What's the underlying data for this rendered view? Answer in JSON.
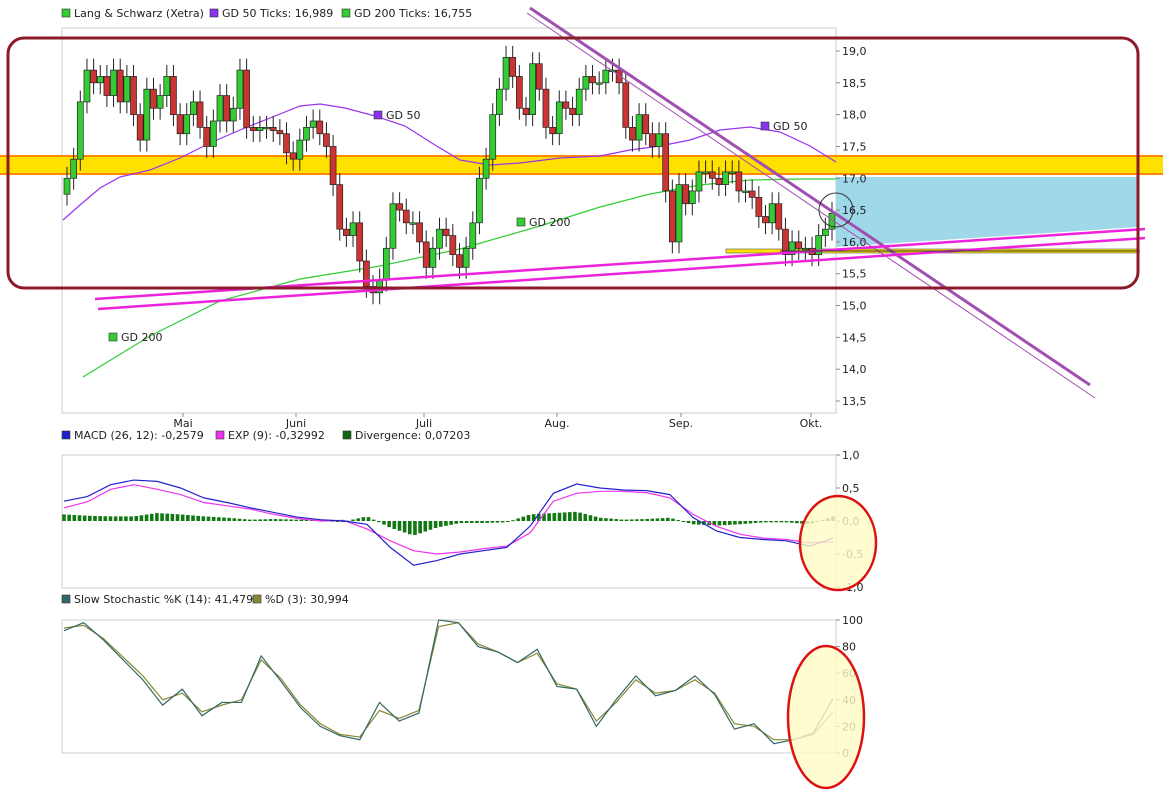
{
  "price_panel": {
    "legend": [
      {
        "label": "Lang & Schwarz (Xetra)",
        "color": "#33cc33"
      },
      {
        "label": "GD 50 Ticks: 16,989",
        "color": "#8833ee"
      },
      {
        "label": "GD 200 Ticks: 16,755",
        "color": "#33cc33"
      }
    ],
    "y_ticks": [
      "19,0",
      "18,5",
      "18,0",
      "17,5",
      "17,0",
      "16,5",
      "16,0",
      "15,5",
      "15,0",
      "14,5",
      "14,0",
      "13,5"
    ],
    "x_ticks": [
      "Mai",
      "Juni",
      "Juli",
      "Aug.",
      "Sep.",
      "Okt."
    ],
    "labels": {
      "gd50_a": "GD 50",
      "gd50_b": "GD 50",
      "gd200_a": "GD 200",
      "gd200_b": "GD 200"
    }
  },
  "macd_panel": {
    "legend": [
      {
        "label": "MACD (26, 12): -0,2579",
        "color": "#2222cc"
      },
      {
        "label": "EXP (9): -0,32992",
        "color": "#ee33ee"
      },
      {
        "label": "Divergence: 0,07203",
        "color": "#116611"
      }
    ],
    "y_ticks": [
      "1,0",
      "0,5",
      "0,0",
      "-0,5",
      "-1,0"
    ]
  },
  "stoch_panel": {
    "legend": [
      {
        "label": "Slow Stochastic %K (14): 41,479",
        "color": "#336666"
      },
      {
        "label": "%D (3): 30,994",
        "color": "#888833"
      }
    ],
    "y_ticks": [
      "100",
      "80",
      "60",
      "40",
      "20",
      "0"
    ]
  },
  "chart_data": [
    {
      "type": "candlestick",
      "title": "Lang & Schwarz (Xetra)",
      "x_ticks": [
        "Mai",
        "Juni",
        "Juli",
        "Aug.",
        "Sep.",
        "Okt."
      ],
      "ylim": [
        13.3,
        19.15
      ],
      "grid": false,
      "series": [
        {
          "name": "Lang & Schwarz (Xetra)",
          "close": [
            17.0,
            17.3,
            18.2,
            18.7,
            18.5,
            18.6,
            18.3,
            18.7,
            18.2,
            18.6,
            18.0,
            17.6,
            18.4,
            18.1,
            18.3,
            18.6,
            18.0,
            17.7,
            18.0,
            18.2,
            17.8,
            17.5,
            17.9,
            18.3,
            17.9,
            18.1,
            18.7,
            17.8,
            17.75,
            17.8,
            17.8,
            17.75,
            17.7,
            17.4,
            17.3,
            17.6,
            17.8,
            17.9,
            17.7,
            17.5,
            16.9,
            16.2,
            16.1,
            16.3,
            15.7,
            15.3,
            15.2,
            15.4,
            15.9,
            16.6,
            16.5,
            16.3,
            16.3,
            16.0,
            15.6,
            15.9,
            16.2,
            16.1,
            15.8,
            15.6,
            15.9,
            16.3,
            17.0,
            17.3,
            18.0,
            18.4,
            18.9,
            18.6,
            18.1,
            18.0,
            18.8,
            18.4,
            17.8,
            17.7,
            18.2,
            18.1,
            18.0,
            18.4,
            18.6,
            18.5,
            18.5,
            18.7,
            18.7,
            18.5,
            17.8,
            17.6,
            18.0,
            17.7,
            17.5,
            17.7,
            16.8,
            16.0,
            16.9,
            16.6,
            16.8,
            17.1,
            17.1,
            17.0,
            16.9,
            17.1,
            17.1,
            16.8,
            16.8,
            16.7,
            16.4,
            16.3,
            16.6,
            16.2,
            15.8,
            16.0,
            15.9,
            15.9,
            15.8,
            16.1,
            16.2,
            16.45
          ]
        }
      ]
    },
    {
      "type": "line",
      "title": "MACD",
      "ylim": [
        -1.0,
        1.0
      ],
      "series": [
        {
          "name": "MACD (26, 12)",
          "values": [
            0.3,
            0.37,
            0.55,
            0.62,
            0.6,
            0.5,
            0.35,
            0.28,
            0.2,
            0.13,
            0.06,
            0.02,
            0.0,
            -0.05,
            -0.4,
            -0.67,
            -0.6,
            -0.5,
            -0.45,
            -0.4,
            -0.08,
            0.42,
            0.56,
            0.5,
            0.47,
            0.46,
            0.4,
            0.05,
            -0.15,
            -0.25,
            -0.28,
            -0.3,
            -0.38,
            -0.26
          ]
        },
        {
          "name": "EXP (9)",
          "values": [
            0.2,
            0.29,
            0.48,
            0.55,
            0.48,
            0.4,
            0.28,
            0.23,
            0.18,
            0.1,
            0.04,
            0.0,
            0.01,
            -0.12,
            -0.3,
            -0.45,
            -0.5,
            -0.47,
            -0.42,
            -0.38,
            -0.18,
            0.3,
            0.42,
            0.45,
            0.45,
            0.43,
            0.35,
            0.1,
            -0.08,
            -0.2,
            -0.26,
            -0.28,
            -0.33,
            -0.32
          ]
        },
        {
          "name": "Divergence",
          "values": [
            0.1,
            0.08,
            0.07,
            0.07,
            0.12,
            0.1,
            0.07,
            0.05,
            0.02,
            0.03,
            0.02,
            0.02,
            -0.01,
            0.07,
            -0.1,
            -0.22,
            -0.1,
            -0.03,
            -0.03,
            -0.02,
            0.1,
            0.12,
            0.14,
            0.05,
            0.02,
            0.03,
            0.05,
            -0.05,
            -0.07,
            -0.05,
            -0.02,
            -0.02,
            -0.05,
            0.07
          ]
        }
      ]
    },
    {
      "type": "line",
      "title": "Slow Stochastic",
      "ylim": [
        0,
        100
      ],
      "series": [
        {
          "name": "Slow Stochastic %K (14)",
          "values": [
            92,
            98,
            85,
            70,
            55,
            36,
            48,
            28,
            38,
            38,
            73,
            54,
            34,
            20,
            13,
            10,
            38,
            24,
            30,
            100,
            98,
            80,
            76,
            68,
            78,
            50,
            48,
            20,
            40,
            58,
            43,
            47,
            58,
            44,
            18,
            22,
            7,
            10,
            15,
            41
          ]
        },
        {
          "name": "%D (3)",
          "values": [
            94,
            96,
            86,
            72,
            58,
            40,
            45,
            31,
            36,
            40,
            70,
            56,
            36,
            22,
            14,
            12,
            32,
            26,
            32,
            95,
            98,
            82,
            76,
            68,
            75,
            52,
            48,
            24,
            38,
            55,
            45,
            47,
            55,
            45,
            22,
            20,
            10,
            10,
            14,
            31
          ]
        }
      ]
    }
  ]
}
